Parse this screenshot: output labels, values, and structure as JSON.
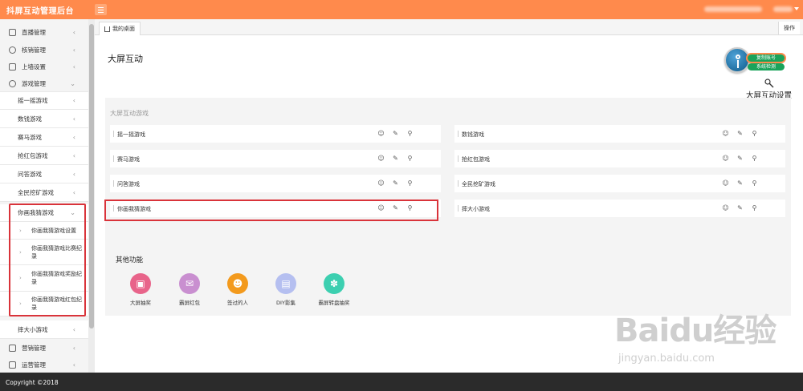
{
  "header": {
    "app_title": "抖屏互动管理后台"
  },
  "sidebar": {
    "items": [
      {
        "label": "直播管理",
        "icon": "live-icon"
      },
      {
        "label": "核销管理",
        "icon": "link-icon"
      },
      {
        "label": "上墙设置",
        "icon": "wall-icon"
      },
      {
        "label": "游戏管理",
        "icon": "palette-icon"
      }
    ],
    "games": [
      "摇一摇游戏",
      "数钱游戏",
      "赛马游戏",
      "抢红包游戏",
      "问答游戏",
      "全民挖矿游戏",
      "你画我猜游戏"
    ],
    "draw_guess_sub": [
      "你画我猜游戏设置",
      "你画我猜游戏比赛纪录",
      "你画我猜游戏奖励纪录",
      "你画我猜游戏红包纪录"
    ],
    "after_game": "摔大小游戏",
    "bottom_items": [
      {
        "label": "营销管理",
        "icon": "chart-icon"
      },
      {
        "label": "运营管理",
        "icon": "settings-icon"
      }
    ]
  },
  "tabs": {
    "home": "我的桌面",
    "ops": "操作"
  },
  "main": {
    "title": "大屏互动",
    "key_badges": [
      "复制账号",
      "系统检测"
    ],
    "settings_label": "大屏互动设置",
    "games_panel_title": "大屏互动游戏",
    "games": [
      "摇一摇游戏",
      "数钱游戏",
      "赛马游戏",
      "抢红包游戏",
      "问答游戏",
      "全民挖矿游戏",
      "你画我猜游戏",
      "摔大小游戏"
    ],
    "other_title": "其他功能",
    "functions": [
      {
        "label": "大屏抽奖",
        "icon": "gift-icon",
        "color": "#e8648a"
      },
      {
        "label": "霸屏红包",
        "icon": "red-packet-icon",
        "color": "#c98fd0"
      },
      {
        "label": "签过的人",
        "icon": "people-icon",
        "color": "#f39a1d"
      },
      {
        "label": "DIY影集",
        "icon": "photo-icon",
        "color": "#b5bff0"
      },
      {
        "label": "霸屏转盘抽奖",
        "icon": "wheel-icon",
        "color": "#3ccfb0"
      }
    ]
  },
  "footer": {
    "copyright": "Copyright ©2018"
  },
  "watermark": {
    "brand": "Baidu经验",
    "url": "jingyan.baidu.com"
  }
}
